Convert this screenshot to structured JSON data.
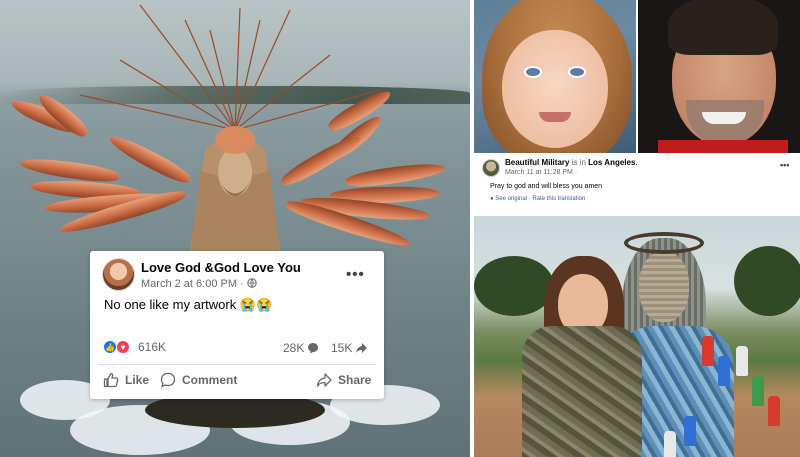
{
  "left_post": {
    "author": "Love God &God Love You",
    "timestamp": "March 2 at 6:00 PM ·",
    "privacy_icon": "globe-icon",
    "more_icon": "•••",
    "text": "No one like my artwork 😭😭",
    "reaction_count": "616K",
    "comment_count": "28K",
    "share_count": "15K",
    "actions": {
      "like": "Like",
      "comment": "Comment",
      "share": "Share"
    }
  },
  "right_post": {
    "author": "Beautiful Military",
    "is_in": "is in",
    "location": "Los Angeles",
    "period": ".",
    "timestamp": "March 11 at 11:28 PM ·",
    "more_icon": "•••",
    "text": "Pray to god and will bless you amen",
    "see_original": "See original",
    "separator": "·",
    "rate_translation": "Rate this translation"
  },
  "colors": {
    "facebook_blue": "#1877f2",
    "love_red": "#f33e58",
    "muted_text": "#65676b",
    "link_blue": "#3b5fa0"
  }
}
